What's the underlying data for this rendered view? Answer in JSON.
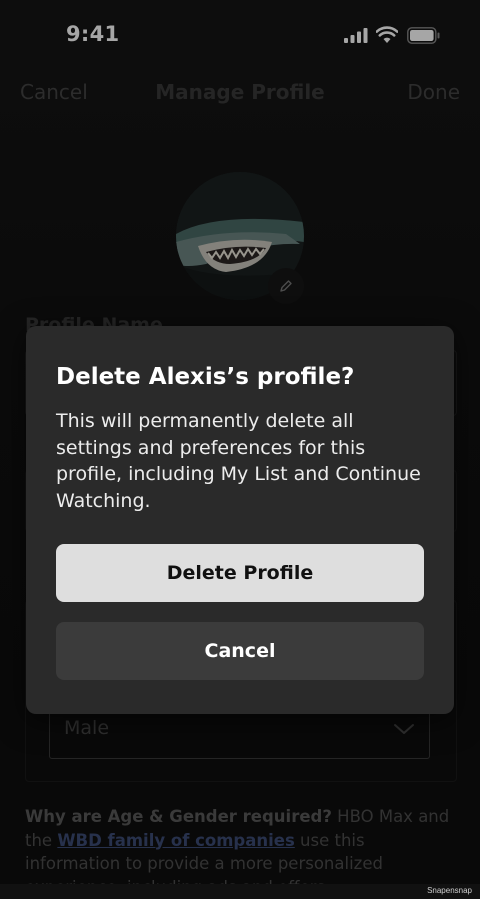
{
  "status_bar": {
    "time": "9:41"
  },
  "nav": {
    "cancel_label": "Cancel",
    "title": "Manage Profile",
    "done_label": "Done"
  },
  "avatar": {
    "icon": "shark-avatar",
    "edit_icon": "pencil-icon"
  },
  "form": {
    "profile_name_label": "Profile Name",
    "gender_value": "Male",
    "gender_chevron_icon": "chevron-down-icon",
    "info_question": "Why are Age & Gender required?",
    "info_text_1": " HBO Max and the ",
    "info_link": "WBD family of companies",
    "info_text_2": " use this information to provide a more personalized experience, including ads and offers."
  },
  "dialog": {
    "title": "Delete Alexis’s profile?",
    "body": "This will permanently delete all settings and preferences for this profile, including My List and Continue Watching.",
    "delete_button": "Delete Profile",
    "cancel_button": "Cancel"
  },
  "watermark": "Snapensnap",
  "colors": {
    "dialog_bg": "#2a2a2a",
    "primary_button_bg": "#dedede",
    "secondary_button_bg": "#3b3b3b",
    "link": "#3d4c75"
  }
}
